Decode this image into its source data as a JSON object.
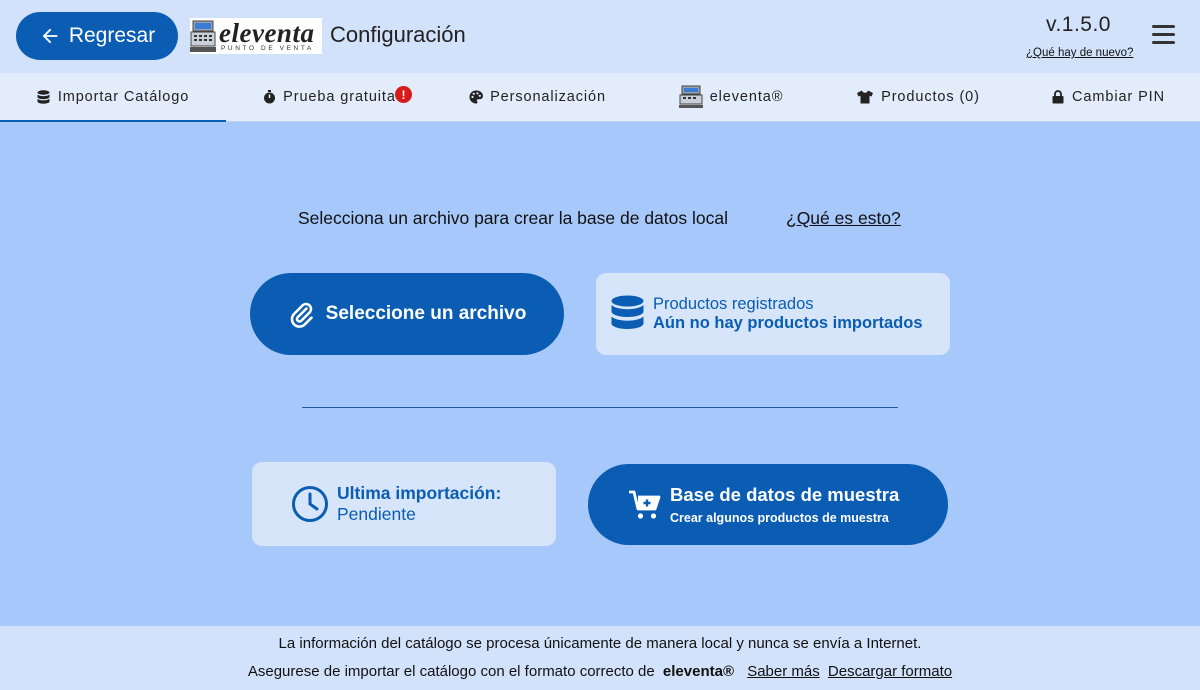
{
  "header": {
    "back_label": "Regresar",
    "logo_word": "eleventa",
    "logo_sub": "PUNTO DE VENTA",
    "title": "Configuración",
    "version": "v.1.5.0",
    "whats_new": "¿Qué hay de nuevo?"
  },
  "tabs": [
    {
      "label": "Importar Catálogo",
      "icon": "database-icon",
      "active": true
    },
    {
      "label": "Prueba gratuita",
      "icon": "stopwatch-icon",
      "badge": "!"
    },
    {
      "label": "Personalización",
      "icon": "palette-icon"
    },
    {
      "label": "eleventa®",
      "icon": "eleventa-register-icon"
    },
    {
      "label": "Productos (0)",
      "icon": "tshirt-icon"
    },
    {
      "label": "Cambiar PIN",
      "icon": "lock-icon"
    }
  ],
  "main": {
    "prompt": "Selecciona un archivo para crear la base de datos local",
    "what_link": "¿Qué es esto?",
    "select_file_label": "Seleccione un archivo",
    "products_card": {
      "title": "Productos registrados",
      "status": "Aún no hay productos importados"
    },
    "import_card": {
      "title": "Ultima importación:",
      "status": "Pendiente"
    },
    "sample_button": {
      "title": "Base de datos de muestra",
      "subtitle": "Crear algunos productos de muestra"
    }
  },
  "footer": {
    "line1": "La información del catálogo se procesa únicamente de manera local y nunca se envía a Internet.",
    "line2_prefix": "Asegurese de importar el catálogo con el formato correcto de",
    "brand": "eleventa®",
    "learn_more": "Saber más",
    "download_format": "Descargar formato"
  },
  "colors": {
    "primary": "#0a5db3",
    "background": "#a7c8fb",
    "header_bg": "#d3e2fb",
    "badge": "#d71a1a"
  }
}
